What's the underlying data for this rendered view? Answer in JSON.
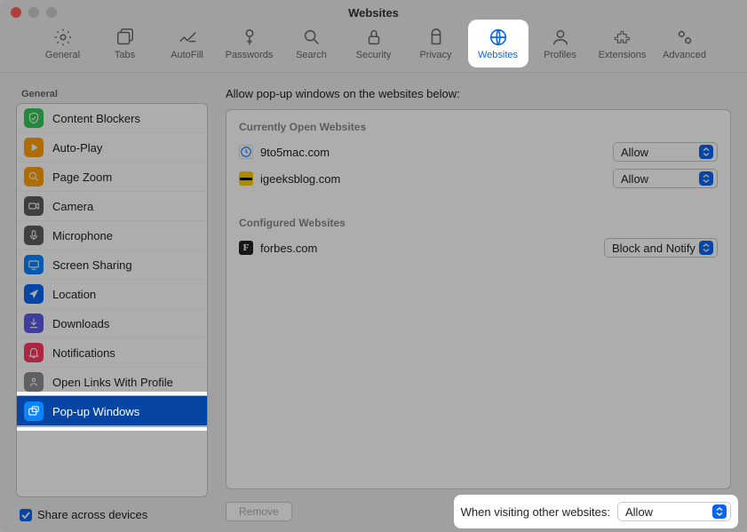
{
  "window": {
    "title": "Websites"
  },
  "toolbar": {
    "items": [
      {
        "id": "general",
        "label": "General"
      },
      {
        "id": "tabs",
        "label": "Tabs"
      },
      {
        "id": "autofill",
        "label": "AutoFill"
      },
      {
        "id": "passwords",
        "label": "Passwords"
      },
      {
        "id": "search",
        "label": "Search"
      },
      {
        "id": "security",
        "label": "Security"
      },
      {
        "id": "privacy",
        "label": "Privacy"
      },
      {
        "id": "websites",
        "label": "Websites"
      },
      {
        "id": "profiles",
        "label": "Profiles"
      },
      {
        "id": "extensions",
        "label": "Extensions"
      },
      {
        "id": "advanced",
        "label": "Advanced"
      }
    ],
    "active_id": "websites"
  },
  "sidebar": {
    "header": "General",
    "items": [
      {
        "label": "Content Blockers",
        "icon": "shield-check",
        "bg": "#34c759"
      },
      {
        "label": "Auto-Play",
        "icon": "play",
        "bg": "#ff9f0a"
      },
      {
        "label": "Page Zoom",
        "icon": "zoom",
        "bg": "#ff9f0a"
      },
      {
        "label": "Camera",
        "icon": "camera",
        "bg": "#5e5e5e"
      },
      {
        "label": "Microphone",
        "icon": "mic",
        "bg": "#5e5e5e"
      },
      {
        "label": "Screen Sharing",
        "icon": "screen",
        "bg": "#0a84ff"
      },
      {
        "label": "Location",
        "icon": "arrow",
        "bg": "#0a66f0"
      },
      {
        "label": "Downloads",
        "icon": "download",
        "bg": "#5e5ce6"
      },
      {
        "label": "Notifications",
        "icon": "bell",
        "bg": "#ff375f"
      },
      {
        "label": "Open Links With Profile",
        "icon": "profile-link",
        "bg": "#8e8e93"
      },
      {
        "label": "Pop-up Windows",
        "icon": "popup",
        "bg": "#0a84ff"
      }
    ],
    "selected_index": 10,
    "share_label": "Share across devices",
    "share_checked": true
  },
  "main": {
    "title": "Allow pop-up windows on the websites below:",
    "sections": [
      {
        "header": "Currently Open Websites",
        "rows": [
          {
            "favicon_bg": "#ffffff",
            "favicon_color": "#0a84ff",
            "favicon_type": "clock",
            "domain": "9to5mac.com",
            "value": "Allow"
          },
          {
            "favicon_bg": "#ffcc00",
            "favicon_color": "#000",
            "favicon_type": "bar",
            "domain": "igeeksblog.com",
            "value": "Allow"
          }
        ]
      },
      {
        "header": "Configured Websites",
        "rows": [
          {
            "favicon_bg": "#222",
            "favicon_color": "#fff",
            "favicon_type": "letter",
            "favicon_letter": "F",
            "domain": "forbes.com",
            "value": "Block and Notify"
          }
        ]
      }
    ],
    "remove_label": "Remove",
    "other_label": "When visiting other websites:",
    "other_value": "Allow"
  },
  "help_label": "?"
}
